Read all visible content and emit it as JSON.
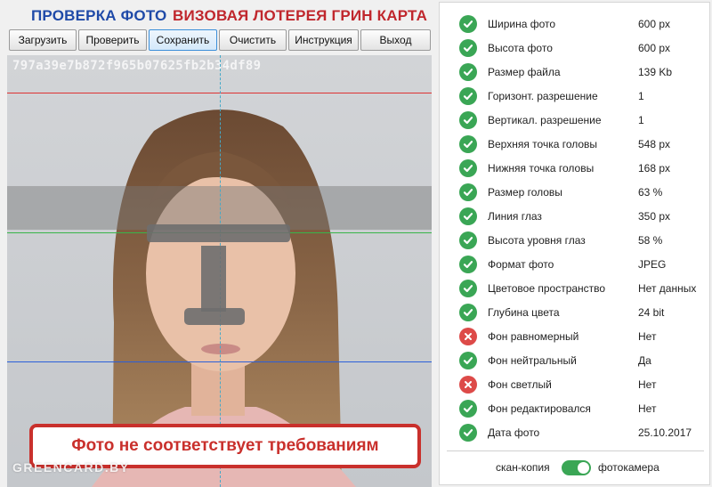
{
  "header": {
    "title_check": "ПРОВЕРКА ФОТО",
    "title_lottery": "ВИЗОВАЯ ЛОТЕРЕЯ ГРИН КАРТА"
  },
  "toolbar": {
    "load_label": "Загрузить",
    "check_label": "Проверить",
    "save_label": "Сохранить",
    "clear_label": "Очистить",
    "manual_label": "Инструкция",
    "exit_label": "Выход"
  },
  "photo": {
    "hash": "797a39e7b872f965b07625fb2b34df89",
    "verdict": "Фото не соответствует требованиям",
    "watermark": "GREENCARD.BY"
  },
  "params": [
    {
      "label": "Ширина фото",
      "value": "600 px",
      "ok": true
    },
    {
      "label": "Высота фото",
      "value": "600 px",
      "ok": true
    },
    {
      "label": "Размер файла",
      "value": "139 Kb",
      "ok": true
    },
    {
      "label": "Горизонт. разрешение",
      "value": "1",
      "ok": true
    },
    {
      "label": "Вертикал. разрешение",
      "value": "1",
      "ok": true
    },
    {
      "label": "Верхняя точка головы",
      "value": "548 px",
      "ok": true
    },
    {
      "label": "Нижняя точка головы",
      "value": "168 px",
      "ok": true
    },
    {
      "label": "Размер головы",
      "value": "63 %",
      "ok": true
    },
    {
      "label": "Линия глаз",
      "value": "350 px",
      "ok": true
    },
    {
      "label": "Высота уровня глаз",
      "value": "58 %",
      "ok": true
    },
    {
      "label": "Формат фото",
      "value": "JPEG",
      "ok": true
    },
    {
      "label": "Цветовое пространство",
      "value": "Нет данных",
      "ok": true
    },
    {
      "label": "Глубина цвета",
      "value": "24 bit",
      "ok": true
    },
    {
      "label": "Фон равномерный",
      "value": "Нет",
      "ok": false
    },
    {
      "label": "Фон нейтральный",
      "value": "Да",
      "ok": true
    },
    {
      "label": "Фон светлый",
      "value": "Нет",
      "ok": false
    },
    {
      "label": "Фон редактировался",
      "value": "Нет",
      "ok": true
    },
    {
      "label": "Дата фото",
      "value": "25.10.2017",
      "ok": true
    }
  ],
  "source_toggle": {
    "left_label": "скан-копия",
    "right_label": "фотокамера",
    "selected": "фотокамера"
  },
  "colors": {
    "ok": "#3aa655",
    "bad": "#dd4a48",
    "accent_red": "#c9302c",
    "title_blue": "#1f4aa8"
  },
  "icons": {
    "ok": "check-icon",
    "bad": "cross-icon"
  }
}
